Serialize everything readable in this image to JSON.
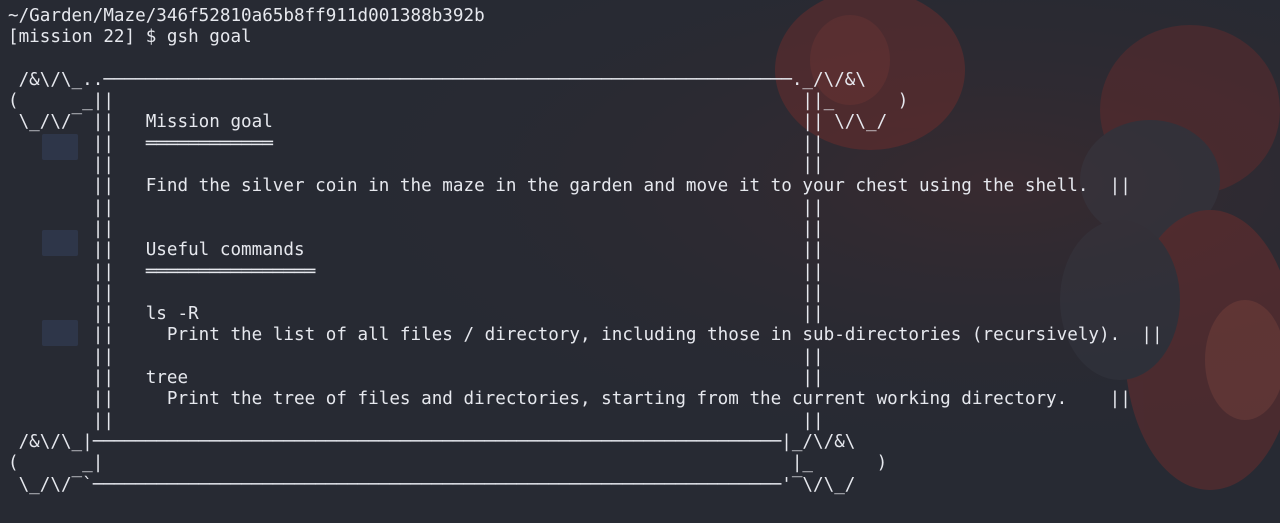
{
  "terminal": {
    "path": "~/Garden/Maze/346f52810a65b8ff911d001388b392b",
    "prompt": "[mission 22] $ ",
    "command": "gsh goal"
  },
  "goal_box": {
    "lines": [
      "",
      " /&\\/\\_..─────────────────────────────────────────────────────────────────._/\\/&\\",
      "(      _||                                                                 ||_      )",
      " \\_/\\/‾ ||   Mission goal                                                  || \\/\\_/",
      "        ||   ════════════                                                  ||",
      "        ||                                                                 ||",
      "        ||   Find the silver coin in the maze in the garden and move it to your chest using the shell.  ||",
      "        ||                                                                 ||",
      "        ||                                                                 ||",
      "        ||   Useful commands                                               ||",
      "        ||   ════════════════                                              ||",
      "        ||                                                                 ||",
      "        ||   ls -R                                                         ||",
      "        ||     Print the list of all files / directory, including those in sub-directories (recursively).  ||",
      "        ||                                                                 ||",
      "        ||   tree                                                          ||",
      "        ||     Print the tree of files and directories, starting from the current working directory.    ||",
      "        ||                                                                 ||",
      " /&\\/\\_|─────────────────────────────────────────────────────────────────|_/\\/&\\",
      "(      _|                                                                 |_      )",
      " \\_/\\/‾`─────────────────────────────────────────────────────────────────'‾\\/\\_/"
    ]
  },
  "colors": {
    "background": "#272a33",
    "text": "#e6e8ee",
    "wallpaper_accent": "#c0392b"
  }
}
